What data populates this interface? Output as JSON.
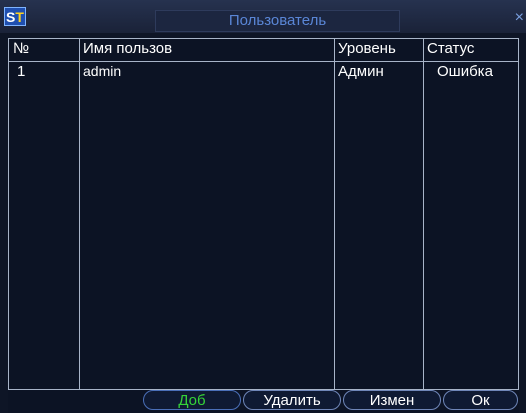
{
  "window": {
    "logo_text": "ST",
    "title": "Пользователь",
    "close_glyph": "×"
  },
  "table": {
    "columns": [
      "№",
      "Имя пользов",
      "Уровень",
      "Статус"
    ],
    "rows": [
      {
        "no": "1",
        "name": "admin",
        "level": "Админ",
        "status": "Ошибка"
      }
    ]
  },
  "buttons": {
    "add": "Доб",
    "delete": "Удалить",
    "edit": "Измен",
    "ok": "Ок"
  },
  "colors": {
    "background": "#0e1526",
    "grid": "#a8b4c8",
    "text": "#ffffff",
    "active_button": "#35d438",
    "title": "#5a86d6"
  }
}
